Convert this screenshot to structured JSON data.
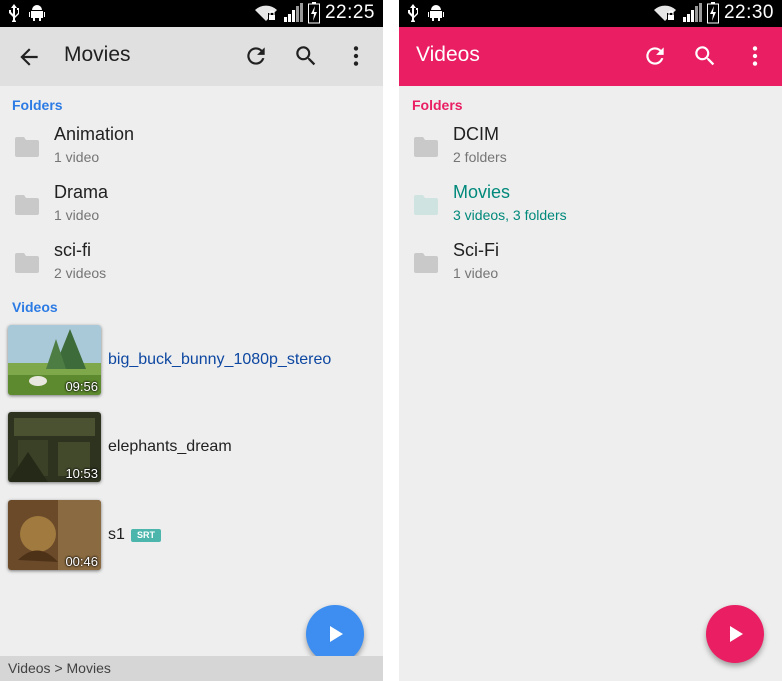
{
  "left": {
    "status": {
      "time": "22:25"
    },
    "toolbar": {
      "title": "Movies",
      "icons": [
        "back-arrow-icon",
        "refresh-icon",
        "search-icon",
        "more-vert-icon"
      ]
    },
    "folders_header": "Folders",
    "folders": [
      {
        "name": "Animation",
        "sub": "1 video"
      },
      {
        "name": "Drama",
        "sub": "1 video"
      },
      {
        "name": "sci-fi",
        "sub": "2 videos"
      }
    ],
    "videos_header": "Videos",
    "videos": [
      {
        "title": "big_buck_bunny_1080p_stereo",
        "duration": "09:56"
      },
      {
        "title": "elephants_dream",
        "duration": "10:53"
      },
      {
        "title": "s1",
        "duration": "00:46",
        "badge": "SRT"
      }
    ],
    "breadcrumb": "Videos > Movies",
    "colors": {
      "accent": "#2c7be5",
      "fab": "#3d8ef0",
      "toolbar_bg": "#e0e0e0"
    }
  },
  "right": {
    "status": {
      "time": "22:30"
    },
    "toolbar": {
      "title": "Videos",
      "icons": [
        "refresh-icon",
        "search-icon",
        "more-vert-icon"
      ]
    },
    "folders_header": "Folders",
    "folders": [
      {
        "name": "DCIM",
        "sub": "2 folders"
      },
      {
        "name": "Movies",
        "sub": "3 videos, 3 folders"
      },
      {
        "name": "Sci-Fi",
        "sub": "1 video"
      }
    ],
    "colors": {
      "accent": "#e91e63",
      "selected": "#00897b",
      "toolbar_bg": "#e91e63"
    }
  }
}
